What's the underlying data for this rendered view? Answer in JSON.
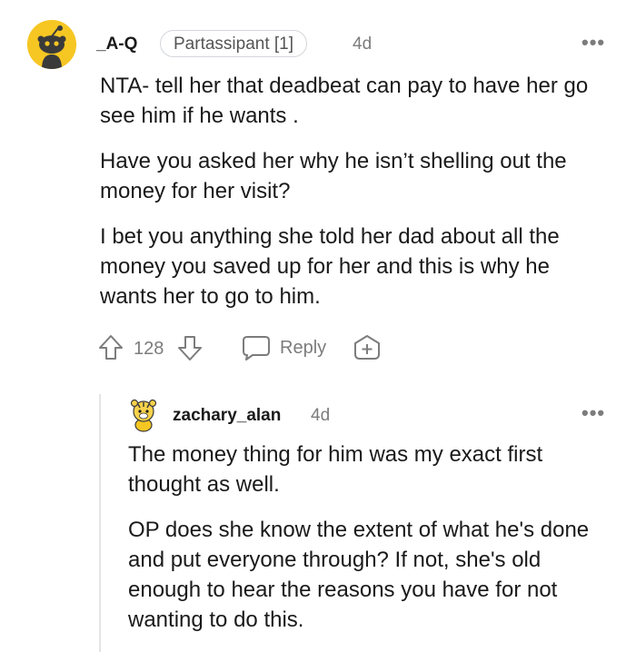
{
  "comment": {
    "username": "_A-Q",
    "flair": "Partassipant [1]",
    "time": "4d",
    "more_label": "•••",
    "paragraphs": [
      "NTA- tell her that deadbeat can pay to have her go see him if he wants .",
      "Have you asked her why he isn’t shelling out the money for her visit?",
      "I bet you anything she told her dad about all the money you saved up for her and this is why he wants her to go to him."
    ],
    "votes": "128",
    "reply_label": "Reply"
  },
  "reply": {
    "username": "zachary_alan",
    "time": "4d",
    "more_label": "•••",
    "paragraphs": [
      "The money thing for him was my exact first thought as well.",
      "OP does she know the extent of what he's done and put everyone through? If not, she's old enough to hear the reasons you have for not wanting to do this."
    ]
  },
  "colors": {
    "avatar_bg": "#f6c623",
    "meta_text": "#7c7c7c",
    "body_text": "#1a1a1b"
  },
  "icons": [
    "reddit-snoo-avatar",
    "upvote-icon",
    "downvote-icon",
    "comment-bubble-icon",
    "award-plus-icon",
    "more-options-icon",
    "tiger-avatar"
  ]
}
